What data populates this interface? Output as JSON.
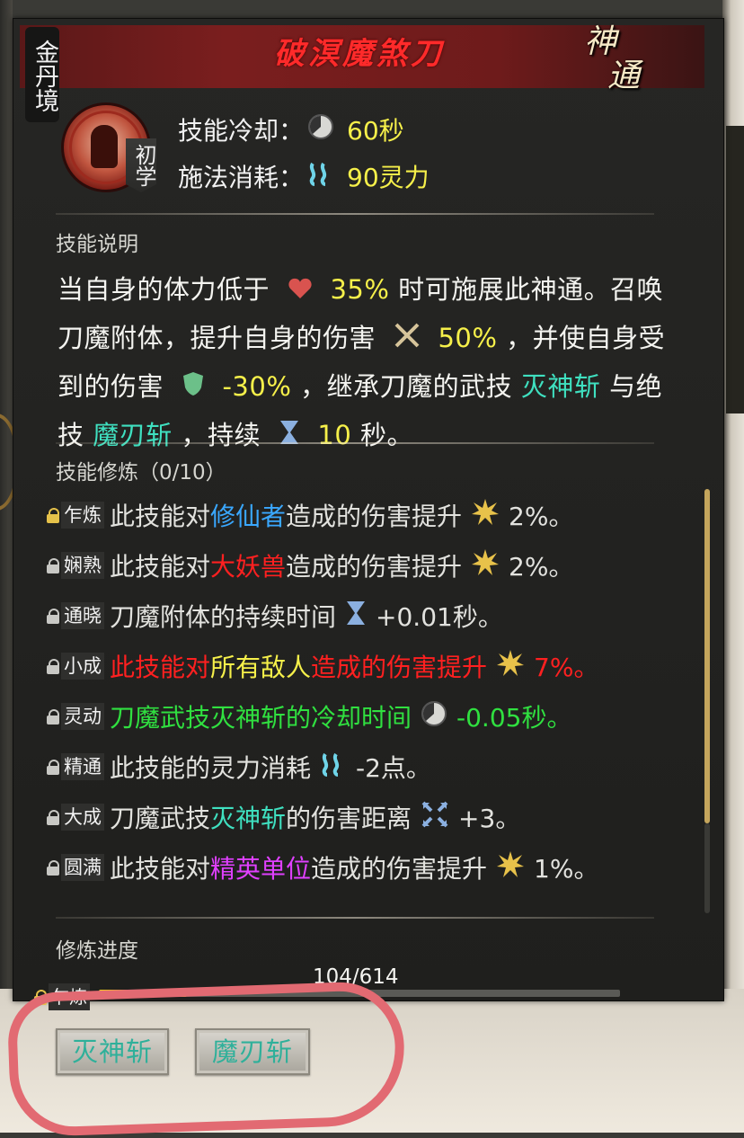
{
  "header": {
    "realm": "金丹境",
    "skill_name": "破溟魔煞刀",
    "category_mark": [
      "神",
      "通"
    ],
    "level": "初学"
  },
  "stats": {
    "cooldown_label": "技能冷却：",
    "cooldown_value": "60秒",
    "cost_label": "施法消耗：",
    "cost_value": "90灵力"
  },
  "description": {
    "label": "技能说明",
    "segments": {
      "s1": "当自身的体力低于",
      "v1": "35%",
      "s2": "时可施展此神通。召唤刀魔附体，提升自身的伤害",
      "v2": "50%",
      "s3": "，并使自身受到的伤害",
      "v3": "-30%",
      "s4": "，继承刀魔的武技",
      "k1": "灭神斩",
      "s5": "与绝技",
      "k2": "魔刃斩",
      "s6": "，持续",
      "v4": "10",
      "s7": "秒。"
    }
  },
  "cultivation": {
    "label": "技能修炼（0/10）",
    "items": [
      {
        "tier": "乍炼",
        "a": "此技能对",
        "b": "修仙者",
        "c": "造成的伤害提升",
        "d": "2%。"
      },
      {
        "tier": "娴熟",
        "a": "此技能对",
        "b": "大妖兽",
        "c": "造成的伤害提升",
        "d": "2%。"
      },
      {
        "tier": "通晓",
        "a": "刀魔附体的持续时间",
        "d": "+0.01秒。"
      },
      {
        "tier": "小成",
        "a": "此技能对",
        "b": "所有敌人",
        "c": "造成的伤害提升",
        "d": "7%。"
      },
      {
        "tier": "灵动",
        "a": "刀魔武技灭神斩的冷却时间",
        "d": "-0.05秒。"
      },
      {
        "tier": "精通",
        "a": "此技能的灵力消耗",
        "d": "-2点。"
      },
      {
        "tier": "大成",
        "a": "刀魔武技",
        "b": "灭神斩",
        "c": "的伤害距离",
        "d": "+3。"
      },
      {
        "tier": "圆满",
        "a": "此技能对",
        "b": "精英单位",
        "c": "造成的伤害提升",
        "d": "1%。"
      }
    ]
  },
  "progress": {
    "label": "修炼进度",
    "text": "104/614",
    "fraction": 0.169,
    "tier": "乍炼"
  },
  "buttons": {
    "b1": "灭神斩",
    "b2": "魔刃斩"
  },
  "colors": {
    "title_red": "#ff2a2a",
    "value_yellow": "#f6f04a",
    "skill_cyan": "#3fe0c0",
    "blue": "#3aa8ff",
    "red": "#ff2020",
    "green": "#30e040",
    "purple": "#e040ff",
    "progress_fill": "#f0c820",
    "annotation": "#e26a72"
  },
  "icons": [
    "cooldown-clock-icon",
    "spirit-energy-icon",
    "heart-icon",
    "crossed-swords-icon",
    "shield-icon",
    "hourglass-icon",
    "burst-star-icon",
    "range-arrows-icon",
    "lock-icon"
  ]
}
